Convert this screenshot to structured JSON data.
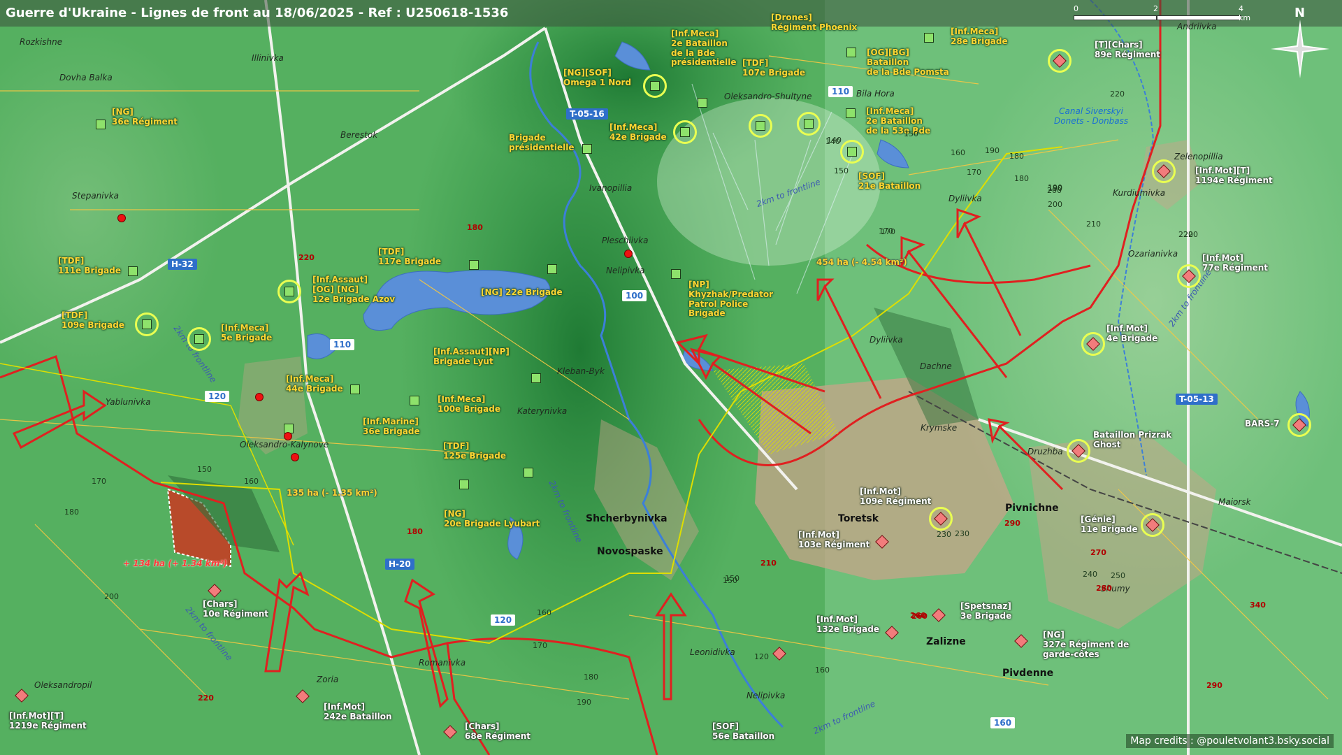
{
  "title": "Guerre d'Ukraine - Lignes de front au 18/06/2025 - Ref : U250618-1536",
  "credits": "Map credits : @pouletvolant3.bsky.social",
  "scale": {
    "ticks": [
      "0",
      "2",
      "4 km"
    ],
    "north": "N"
  },
  "colors": {
    "ukraine_unit": "#8ee26b",
    "russia_unit": "#f27c7c",
    "frontline": "#e02020",
    "grey_zone": "#e0e000",
    "water": "#5a8fd8",
    "terrain": "#4fa55b"
  },
  "roads": [
    "T-05-16",
    "H-32",
    "H-20",
    "T-05-13",
    "110",
    "100",
    "110",
    "120",
    "120",
    "160"
  ],
  "areas": {
    "gain_ru_west": "135 ha (- 1.35 km²)",
    "gain_ru_north": "454 ha (- 4.54 km²)",
    "gain_ua_west": "+ 134 ha (+ 1.34 km²)"
  },
  "canal": "Canal Siverskyi\nDonets - Donbass",
  "frontline_notes": [
    "2km to frontline",
    "2km to frontline",
    "2km to frontline",
    "2km to frontline",
    "2km to frontline",
    "2km to frontline"
  ],
  "ua_units": [
    "[Drones]\nRégiment Phoenix",
    "[Inf.Meca]\n2e Bataillon\nde la Bde\nprésidentielle",
    "[NG][SOF]\nOmega 1 Nord",
    "[TDF]\n107e Brigade",
    "[OG][BG]\nBataillon\nde la Bde Pomsta",
    "[Inf.Meca]\n28e Brigade",
    "[Inf.Meca]\n2e Bataillon\nde la 53e Bde",
    "[Inf.Meca]\n42e Brigade",
    "Brigade\nprésidentielle",
    "[SOF]\n21e Bataillon",
    "[NG]\n36e Régiment",
    "[TDF]\n111e Brigade",
    "[TDF]\n117e Brigade",
    "[Inf.Assaut]\n[OG] [NG]\n12e Brigade Azov",
    "[NG] 22e Brigade",
    "[NP]\nKhyzhak/Predator\nPatrol Police\nBrigade",
    "[TDF]\n109e Brigade",
    "[Inf.Meca]\n5e Brigade",
    "[Inf.Assaut][NP]\nBrigade Lyut",
    "[Inf.Meca]\n44e Brigade",
    "[Inf.Meca]\n100e Brigade",
    "[Inf.Marine]\n36e Brigade",
    "[TDF]\n125e Brigade",
    "[NG]\n20e Brigade Lyubart"
  ],
  "ru_units": [
    "[T][Chars]\n89e Régiment",
    "[Inf.Mot][T]\n1194e Régiment",
    "[Inf.Mot]\n77e Régiment",
    "[Inf.Mot]\n4e Brigade",
    "BARS-7",
    "Bataillon Prizrak\nGhost",
    "[Inf.Mot]\n109e Régiment",
    "[Génie]\n11e Brigade",
    "[Inf.Mot]\n103e Régiment",
    "[Spetsnaz]\n3e Brigade",
    "[Inf.Mot]\n132e Brigade",
    "[NG]\n327e Régiment de\ngarde-côtes",
    "[Chars]\n10e Régiment",
    "[Inf.Mot]\n242e Bataillon",
    "[Chars]\n68e Régiment",
    "[SOF]\n56e Bataillon",
    "[Inf.Mot][T]\n1219e Régiment"
  ],
  "places": [
    "Rozkishne",
    "Illinivka",
    "Dovha Balka",
    "Berestok",
    "Stepanivka",
    "Oleksandro-Shultyne",
    "Bila Hora",
    "Andriivka",
    "Ivanopillia",
    "Pleschiivka",
    "Nelipivka",
    "Kleban-Byk",
    "Katerynivka",
    "Yablunivka",
    "Oleksandro-Kalynove",
    "Dyliivka",
    "Dyliivka",
    "Dachne",
    "Krymske",
    "Druzhba",
    "Zelenopillia",
    "Kurdiumivka",
    "Ozarianivka",
    "Maiorsk",
    "Shumy",
    "Leonidivka",
    "Nelipivka",
    "Romanivka",
    "Zoria",
    "Oleksandropil"
  ],
  "towns": [
    "Shcherbynivka",
    "Novospaske",
    "Toretsk",
    "Pivnichne",
    "Zalizne",
    "Pivdenne"
  ],
  "contours": [
    "220",
    "180",
    "170",
    "150",
    "160",
    "180",
    "200",
    "220",
    "180",
    "190",
    "170",
    "160",
    "170",
    "180",
    "150",
    "140",
    "150",
    "160",
    "170",
    "180",
    "190",
    "200",
    "210",
    "220",
    "220",
    "200",
    "190",
    "230",
    "240",
    "250",
    "260",
    "270",
    "280",
    "290",
    "290",
    "340",
    "150",
    "120",
    "160",
    "230",
    "210",
    "260",
    "220",
    "180",
    "170",
    "150",
    "140",
    "190"
  ]
}
